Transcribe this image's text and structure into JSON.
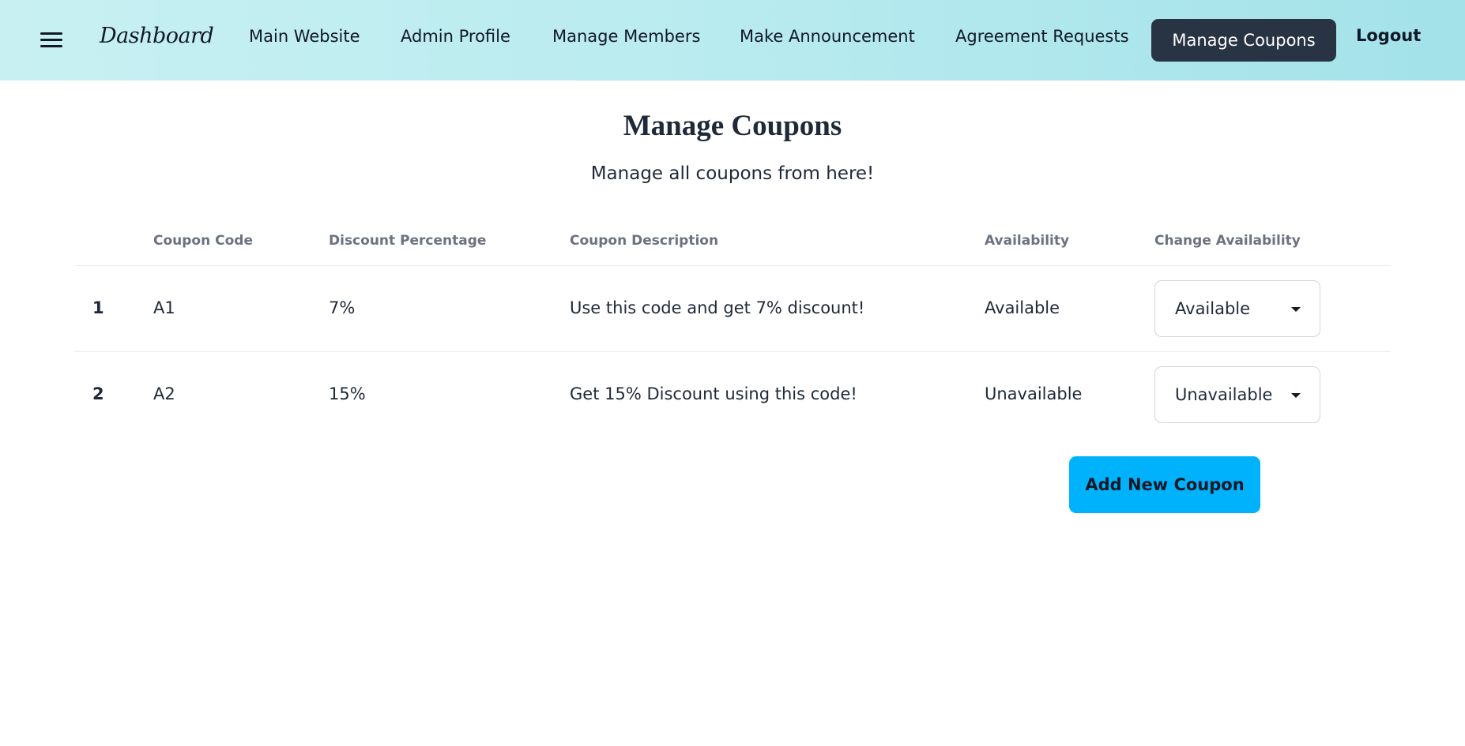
{
  "nav": {
    "brand": "Dashboard",
    "links": [
      {
        "label": "Main Website"
      },
      {
        "label": "Admin Profile"
      },
      {
        "label": "Manage Members"
      },
      {
        "label": "Make Announcement"
      },
      {
        "label": "Agreement Requests"
      }
    ],
    "active_label": "Manage Coupons",
    "logout_label": "Logout",
    "menu_icon": "hamburger-menu-icon"
  },
  "page": {
    "title": "Manage Coupons",
    "subtitle": "Manage all coupons from here!"
  },
  "table": {
    "headers": [
      "Coupon Code",
      "Discount Percentage",
      "Coupon Description",
      "Availability",
      "Change Availability"
    ],
    "rows": [
      {
        "num": "1",
        "code": "A1",
        "discount": "7%",
        "description": "Use this code and get 7% discount!",
        "availability": "Available",
        "select_value": "Available"
      },
      {
        "num": "2",
        "code": "A2",
        "discount": "15%",
        "description": "Get 15% Discount using this code!",
        "availability": "Unavailable",
        "select_value": "Unavailable"
      }
    ]
  },
  "actions": {
    "add_label": "Add New Coupon"
  },
  "colors": {
    "nav_gradient_start": "#c8f0f3",
    "nav_gradient_end": "#a3e2e9",
    "active_nav_bg": "#283443",
    "add_button_bg": "#00b2fb",
    "header_text": "#6b7280"
  }
}
